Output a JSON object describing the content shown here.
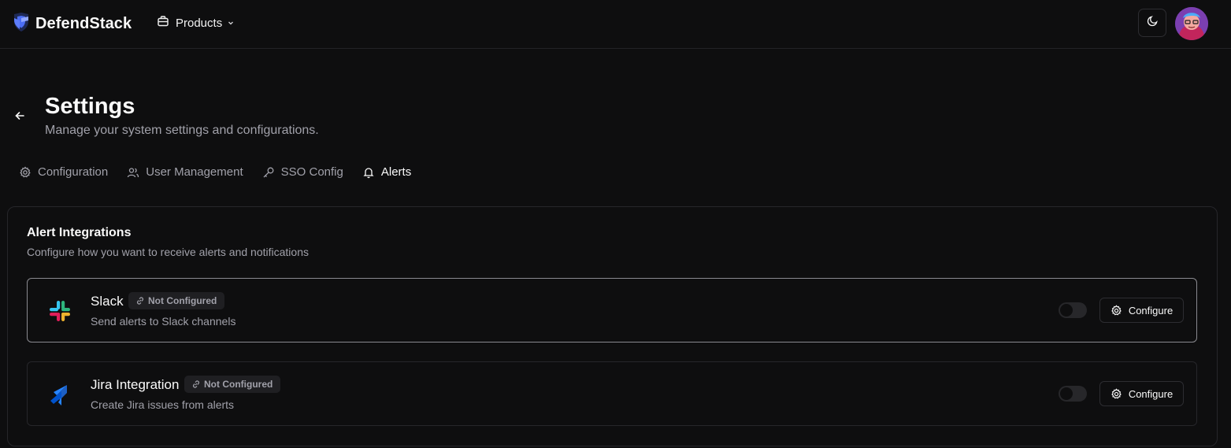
{
  "header": {
    "brand": "DefendStack",
    "products_label": "Products",
    "icons": [
      "shield-logo-icon",
      "briefcase-icon",
      "chevron-down-icon",
      "moon-icon",
      "avatar"
    ]
  },
  "page": {
    "title": "Settings",
    "subtitle": "Manage your system settings and configurations."
  },
  "tabs": [
    {
      "label": "Configuration",
      "icon": "gear-icon",
      "active": false
    },
    {
      "label": "User Management",
      "icon": "users-icon",
      "active": false
    },
    {
      "label": "SSO Config",
      "icon": "key-icon",
      "active": false
    },
    {
      "label": "Alerts",
      "icon": "bell-icon",
      "active": true
    }
  ],
  "alerts": {
    "title": "Alert Integrations",
    "subtitle": "Configure how you want to receive alerts and notifications",
    "integrations": [
      {
        "name": "Slack",
        "status": "Not Configured",
        "description": "Send alerts to Slack channels",
        "enabled": false,
        "button": "Configure",
        "icon": "slack-icon"
      },
      {
        "name": "Jira Integration",
        "status": "Not Configured",
        "description": "Create Jira issues from alerts",
        "enabled": false,
        "button": "Configure",
        "icon": "jira-icon"
      }
    ]
  },
  "colors": {
    "background": "#0e0e0f",
    "border": "#26262a",
    "muted_text": "#a1a1aa",
    "text": "#fafafa"
  }
}
